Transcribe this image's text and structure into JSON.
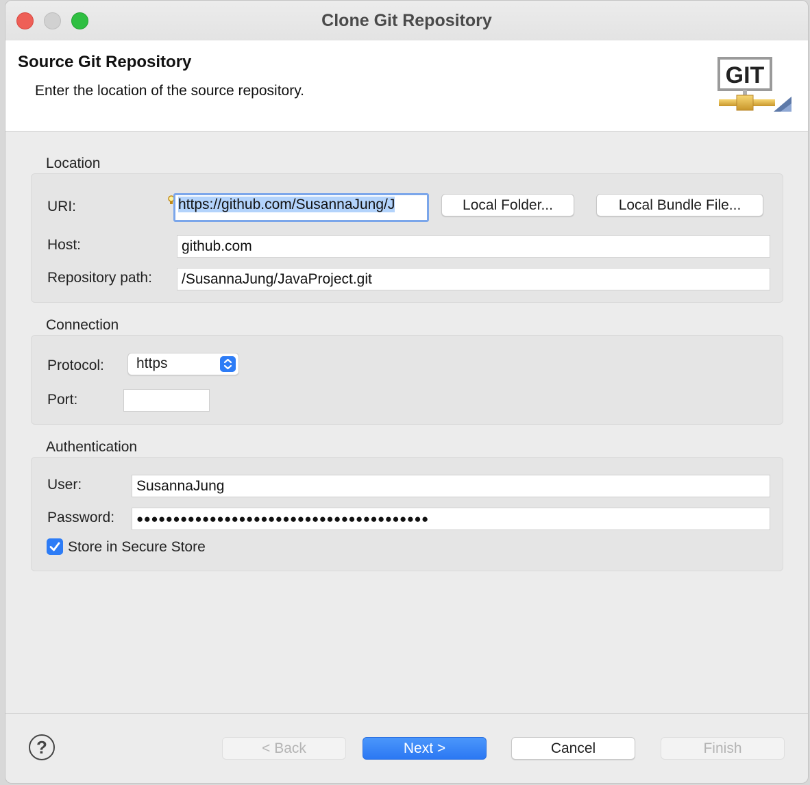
{
  "window": {
    "title": "Clone Git Repository"
  },
  "header": {
    "title": "Source Git Repository",
    "description": "Enter the location of the source repository.",
    "logo_text": "GIT",
    "logo_icon": "git-repository-icon"
  },
  "location": {
    "group_label": "Location",
    "uri_label": "URI:",
    "uri_value": "https://github.com/SusannaJung/J",
    "local_folder_button": "Local Folder...",
    "local_bundle_button": "Local Bundle File...",
    "host_label": "Host:",
    "host_value": "github.com",
    "repo_path_label": "Repository path:",
    "repo_path_value": "/SusannaJung/JavaProject.git"
  },
  "connection": {
    "group_label": "Connection",
    "protocol_label": "Protocol:",
    "protocol_value": "https",
    "port_label": "Port:",
    "port_value": ""
  },
  "authentication": {
    "group_label": "Authentication",
    "user_label": "User:",
    "user_value": "SusannaJung",
    "password_label": "Password:",
    "password_value": "●●●●●●●●●●●●●●●●●●●●●●●●●●●●●●●●●●●●●●●●",
    "store_label": "Store in Secure Store",
    "store_checked": true
  },
  "footer": {
    "help_icon": "help-icon",
    "back_label": "< Back",
    "next_label": "Next >",
    "cancel_label": "Cancel",
    "finish_label": "Finish"
  },
  "colors": {
    "accent": "#2d7cf6",
    "close": "#ee5f57",
    "maximize": "#2fbf42"
  }
}
